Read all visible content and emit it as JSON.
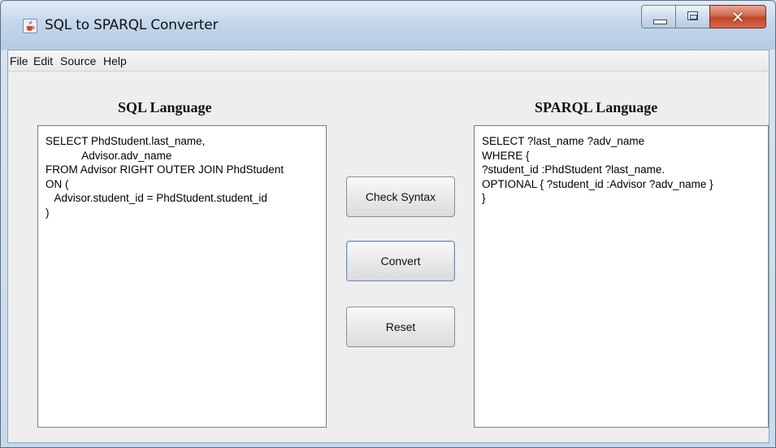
{
  "window": {
    "title": "SQL to SPARQL Converter"
  },
  "menu": [
    "File",
    "Edit",
    "Source",
    "Help"
  ],
  "sql_panel": {
    "title": "SQL Language",
    "text": "SELECT PhdStudent.last_name,\n            Advisor.adv_name\nFROM Advisor RIGHT OUTER JOIN PhdStudent\nON (\n   Advisor.student_id = PhdStudent.student_id\n)"
  },
  "sparql_panel": {
    "title": "SPARQL Language",
    "text": "SELECT ?last_name ?adv_name\nWHERE {\n?student_id :PhdStudent ?last_name.\nOPTIONAL { ?student_id :Advisor ?adv_name }\n}"
  },
  "buttons": {
    "check_syntax": "Check Syntax",
    "convert": "Convert",
    "reset": "Reset"
  },
  "icons": {
    "app": "java-cup-icon",
    "minimize": "minimize-icon",
    "maximize": "maximize-icon",
    "close": "close-icon"
  }
}
